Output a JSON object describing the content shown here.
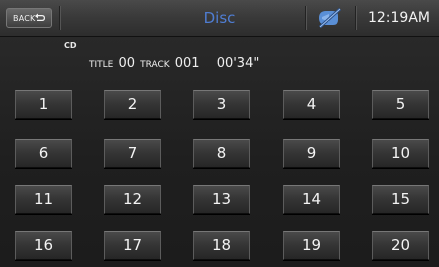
{
  "header": {
    "back_label": "BACK",
    "title": "Disc",
    "time": "12:19AM",
    "status_icon": "bluetooth-off-icon"
  },
  "info": {
    "source": "CD",
    "title_label": "TITLE",
    "title_number": "00",
    "track_label": "TRACK",
    "track_number": "001",
    "elapsed": "00'34\""
  },
  "keypad": {
    "keys": [
      "1",
      "2",
      "3",
      "4",
      "5",
      "6",
      "7",
      "8",
      "9",
      "10",
      "11",
      "12",
      "13",
      "14",
      "15",
      "16",
      "17",
      "18",
      "19",
      "20"
    ]
  },
  "colors": {
    "title_text": "#4f7dd2",
    "background": "#252525",
    "icon_blue": "#5a8fd6"
  }
}
